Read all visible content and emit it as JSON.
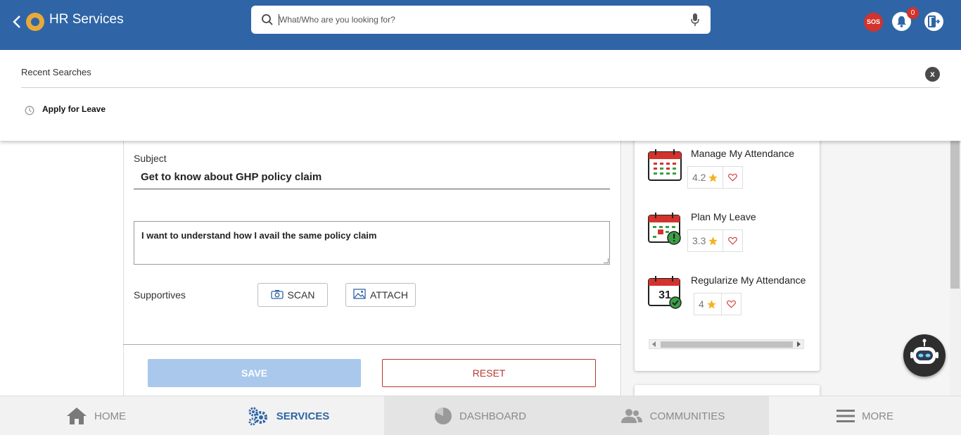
{
  "header": {
    "title": "HR Services",
    "search_placeholder": "What/Who are you looking for?",
    "sos_label": "SOS",
    "notification_count": "0"
  },
  "recent": {
    "title": "Recent Searches",
    "close_label": "x",
    "items": [
      {
        "label": "Apply for Leave"
      }
    ]
  },
  "form": {
    "subject_label": "Subject",
    "subject_value": "Get to know about GHP policy claim",
    "description": "I want to understand how I avail the same policy claim",
    "supportives_label": "Supportives",
    "scan_label": "SCAN",
    "attach_label": "ATTACH",
    "save_label": "SAVE",
    "reset_label": "RESET"
  },
  "services": [
    {
      "name": "Manage My Attendance",
      "rating": "4.2",
      "icon": "attendance-calendar-icon"
    },
    {
      "name": "Plan My Leave",
      "rating": "3.3",
      "icon": "leave-calendar-icon"
    },
    {
      "name": "Regularize My Attendance",
      "rating": "4",
      "icon": "regularize-calendar-icon",
      "day": "31"
    }
  ],
  "nav": {
    "home": "HOME",
    "services": "SERVICES",
    "dashboard": "DASHBOARD",
    "communities": "COMMUNITIES",
    "more": "MORE"
  },
  "colors": {
    "header_bg": "#2f65a6",
    "accent": "#2f65a6",
    "sos": "#d2332c",
    "reset": "#b5382f",
    "save_disabled": "#a9c8ec",
    "star": "#f4b324"
  }
}
